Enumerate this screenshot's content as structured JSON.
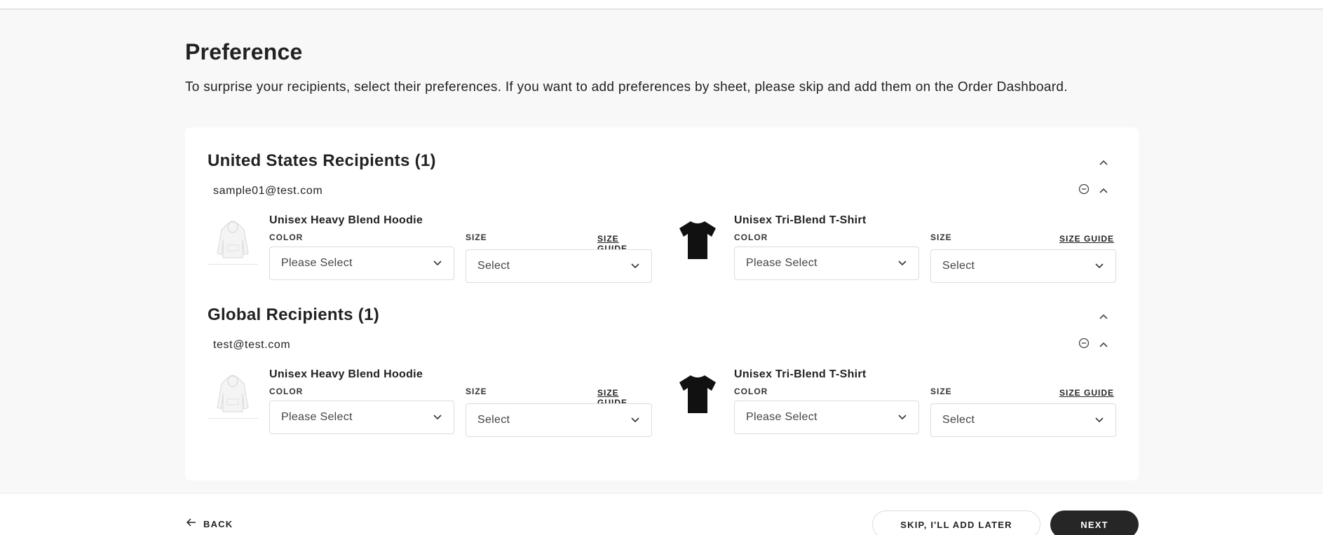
{
  "page": {
    "title": "Preference",
    "subtitle": "To surprise your recipients, select their preferences. If you want to add preferences by sheet, please skip and add them on the Order Dashboard."
  },
  "sections": [
    {
      "title": "United States Recipients (1)",
      "recipients": [
        {
          "email": "sample01@test.com",
          "products": [
            {
              "name": "Unisex Heavy Blend Hoodie",
              "image_icon": "hoodie-icon",
              "color_label": "COLOR",
              "color_value": "Please Select",
              "size_label": "SIZE",
              "size_guide": "SIZE GUIDE",
              "size_value": "Select"
            },
            {
              "name": "Unisex Tri-Blend T-Shirt",
              "image_icon": "tshirt-icon",
              "color_label": "COLOR",
              "color_value": "Please Select",
              "size_label": "SIZE",
              "size_guide": "SIZE GUIDE",
              "size_value": "Select"
            }
          ]
        }
      ]
    },
    {
      "title": "Global Recipients (1)",
      "recipients": [
        {
          "email": "test@test.com",
          "products": [
            {
              "name": "Unisex Heavy Blend Hoodie",
              "image_icon": "hoodie-icon",
              "color_label": "COLOR",
              "color_value": "Please Select",
              "size_label": "SIZE",
              "size_guide": "SIZE GUIDE",
              "size_value": "Select"
            },
            {
              "name": "Unisex Tri-Blend T-Shirt",
              "image_icon": "tshirt-icon",
              "color_label": "COLOR",
              "color_value": "Please Select",
              "size_label": "SIZE",
              "size_guide": "SIZE GUIDE",
              "size_value": "Select"
            }
          ]
        }
      ]
    }
  ],
  "footer": {
    "back_label": "BACK",
    "skip_label": "SKIP, I'LL ADD LATER",
    "next_label": "NEXT"
  },
  "colors": {
    "background": "#f8f8f8",
    "card": "#ffffff",
    "primary_button": "#262626",
    "text": "#222222"
  }
}
